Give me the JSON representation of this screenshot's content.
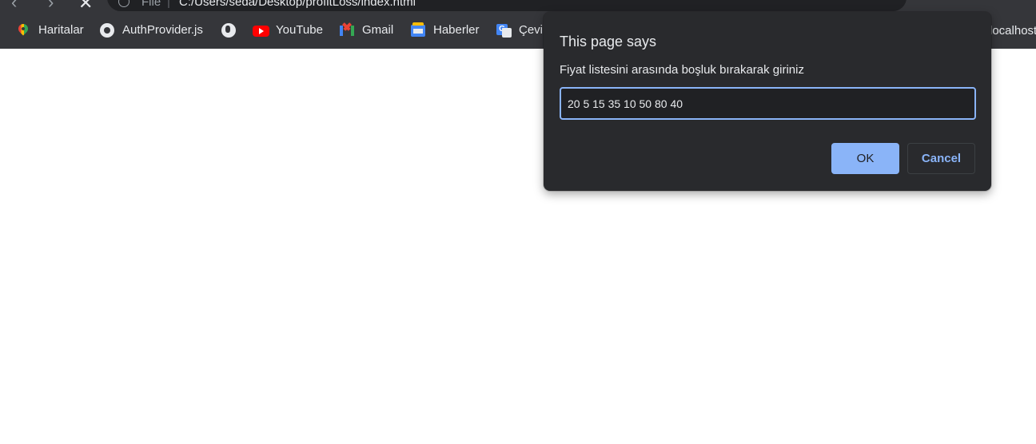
{
  "browser": {
    "address": {
      "scheme_label": "File",
      "url": "C:/Users/seda/Desktop/profitLoss/index.html"
    },
    "bookmarks": [
      {
        "label": "Haritalar",
        "icon": "maps-pin-icon"
      },
      {
        "label": "AuthProvider.js",
        "icon": "github-icon"
      },
      {
        "label": "",
        "icon": "globe-icon"
      },
      {
        "label": "YouTube",
        "icon": "youtube-icon"
      },
      {
        "label": "Gmail",
        "icon": "gmail-icon"
      },
      {
        "label": "Haberler",
        "icon": "news-icon"
      },
      {
        "label": "Çevir",
        "icon": "translate-icon"
      }
    ],
    "bookmark_overflow": "localhost"
  },
  "dialog": {
    "title": "This page says",
    "message": "Fiyat listesini arasında boşluk bırakarak giriniz",
    "input_value": "20 5 15 35 10 50 80 40",
    "ok_label": "OK",
    "cancel_label": "Cancel"
  },
  "colors": {
    "chrome_bg": "#35363a",
    "dialog_bg": "#292a2d",
    "accent": "#8ab4f8"
  }
}
